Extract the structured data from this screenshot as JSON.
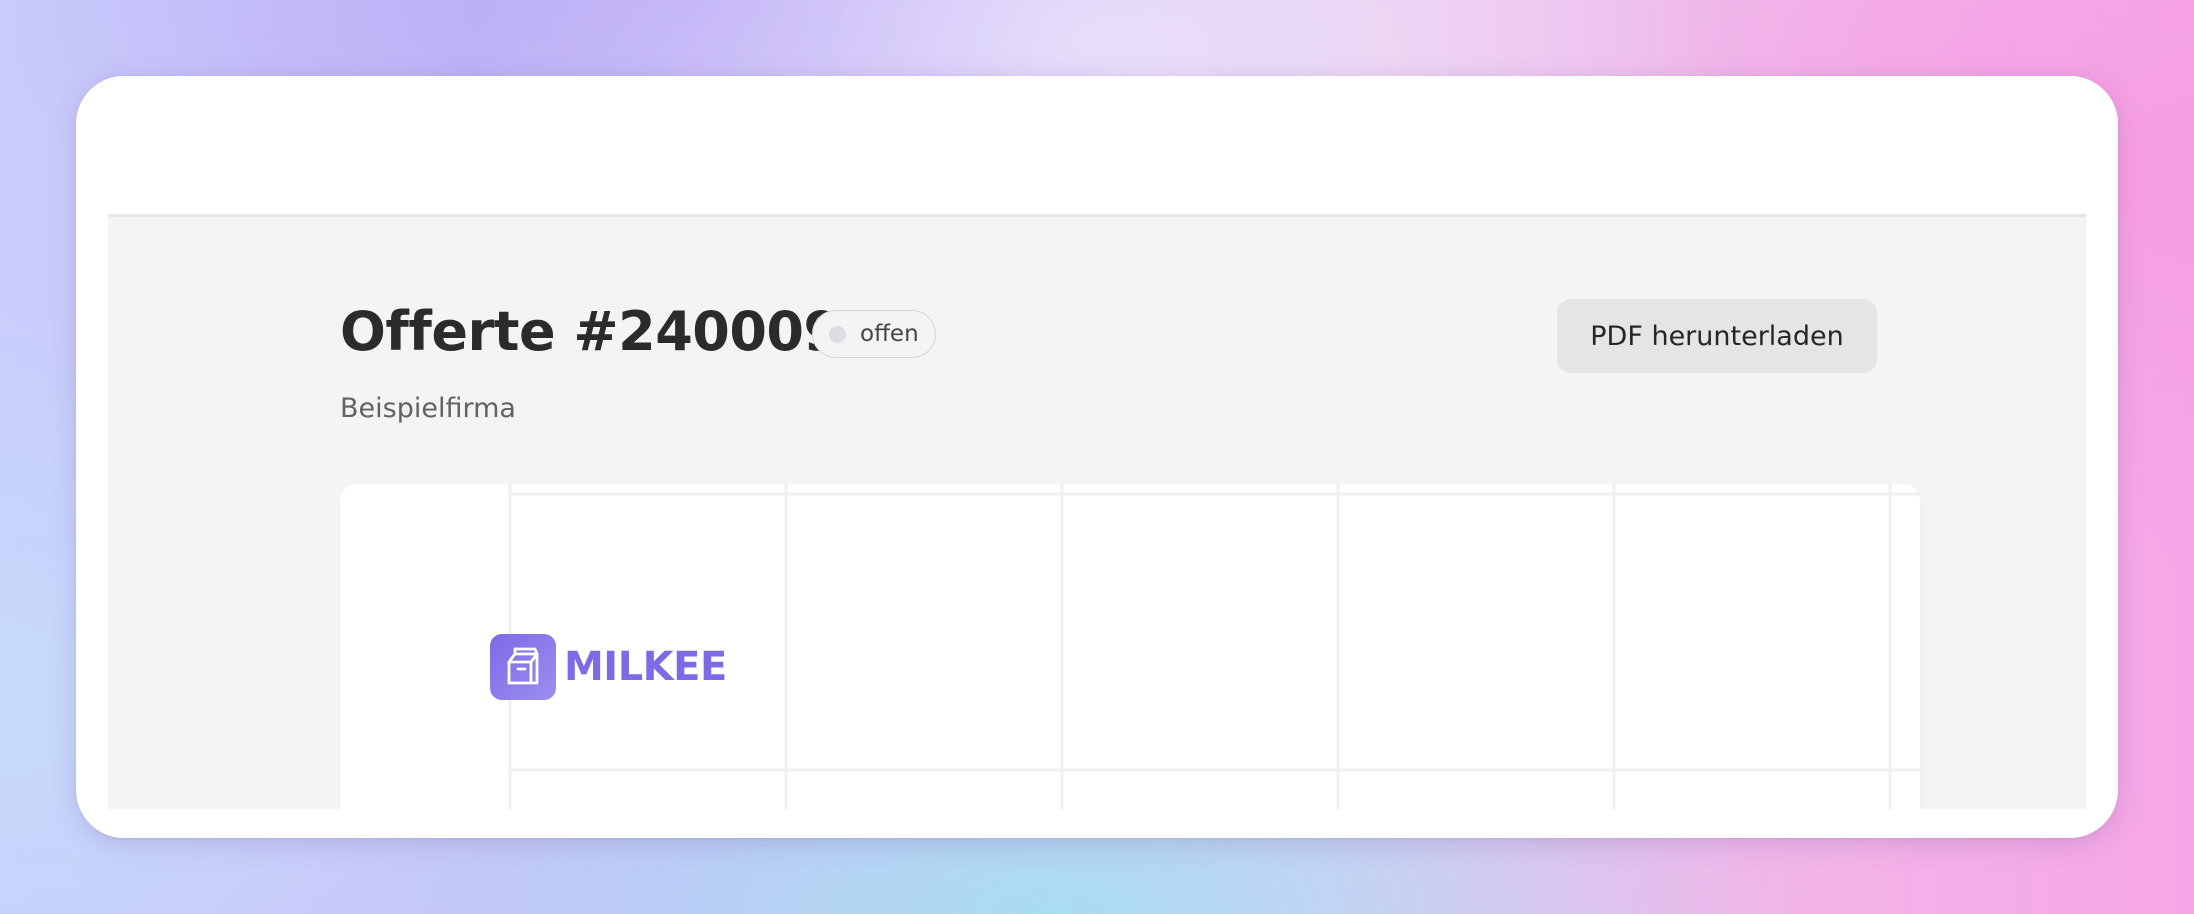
{
  "offer": {
    "title": "Offerte #240009",
    "status": "offen",
    "company": "Beispielfirma"
  },
  "actions": {
    "download_pdf_label": "PDF herunterladen"
  },
  "document": {
    "logo_text": "MILKEE",
    "logo_icon": "milk-carton-icon"
  },
  "colors": {
    "accent": "#7C6AE6",
    "app_background": "#F3F4F6",
    "button_background": "#E5E5E6",
    "status_dot": "#DCDDE0"
  }
}
